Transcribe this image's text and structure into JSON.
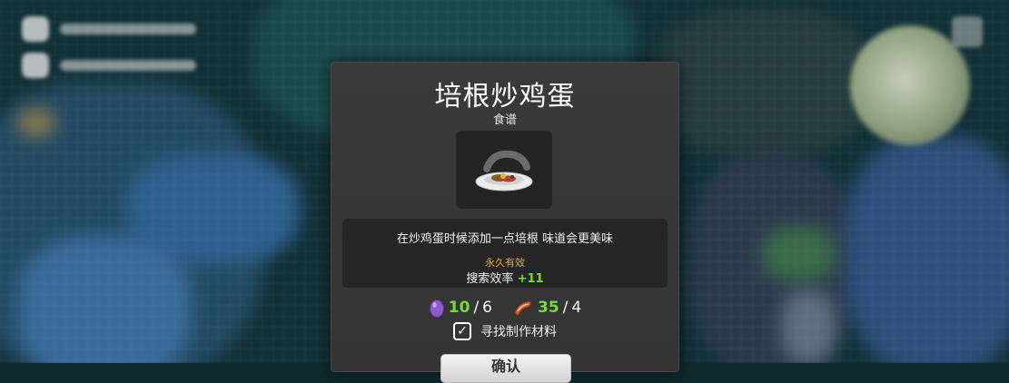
{
  "recipe": {
    "title": "培根炒鸡蛋",
    "category": "食谱",
    "icon": "bacon-egg-plate",
    "description": "在炒鸡蛋时候添加一点培根 味道会更美味",
    "duration": "永久有效",
    "buff_label": "搜索效率",
    "buff_value": "+11"
  },
  "ingredients": [
    {
      "icon": "purple-egg",
      "have": "10",
      "need": "6"
    },
    {
      "icon": "bacon",
      "have": "35",
      "need": "4"
    }
  ],
  "find_materials": {
    "label": "寻找制作材料",
    "checked": true
  },
  "confirm_label": "确认",
  "colors": {
    "positive": "#6fe038",
    "accent": "#f0a52c",
    "panel": "#383838"
  }
}
